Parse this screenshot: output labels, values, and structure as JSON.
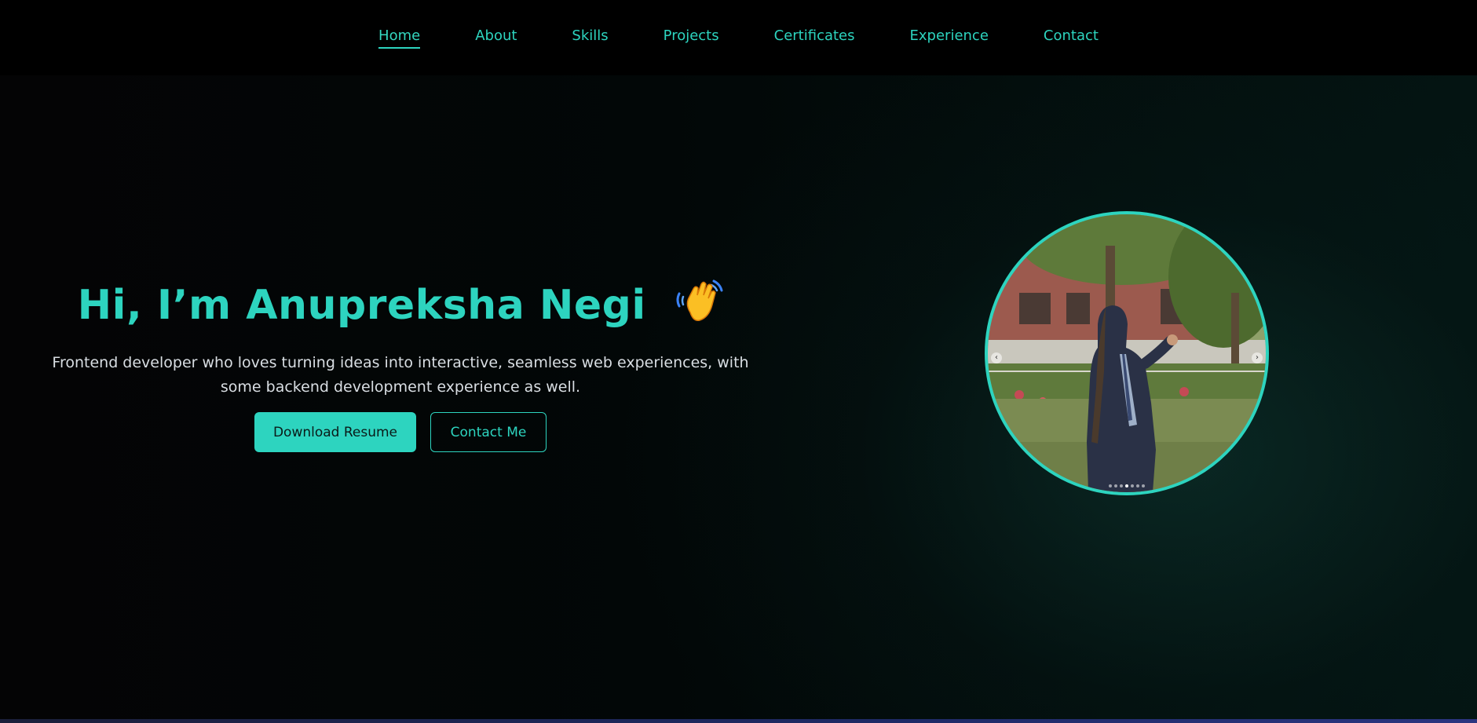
{
  "nav": {
    "items": [
      {
        "label": "Home",
        "active": true
      },
      {
        "label": "About"
      },
      {
        "label": "Skills"
      },
      {
        "label": "Projects"
      },
      {
        "label": "Certificates"
      },
      {
        "label": "Experience"
      },
      {
        "label": "Contact"
      }
    ]
  },
  "hero": {
    "title": "Hi, I’m Anupreksha Negi",
    "wave_icon": "waving-hand-icon",
    "subtitle": "Frontend developer who loves turning ideas into interactive, seamless web experiences, with some backend development experience as well.",
    "primary_button": "Download Resume",
    "secondary_button": "Contact Me"
  },
  "photo": {
    "carousel_slide_count": 7,
    "active_slide": 4,
    "prev_icon": "chevron-left-icon",
    "next_icon": "chevron-right-icon"
  },
  "colors": {
    "accent": "#2dd4bf",
    "background": "#000000",
    "text": "#d9dee3"
  }
}
